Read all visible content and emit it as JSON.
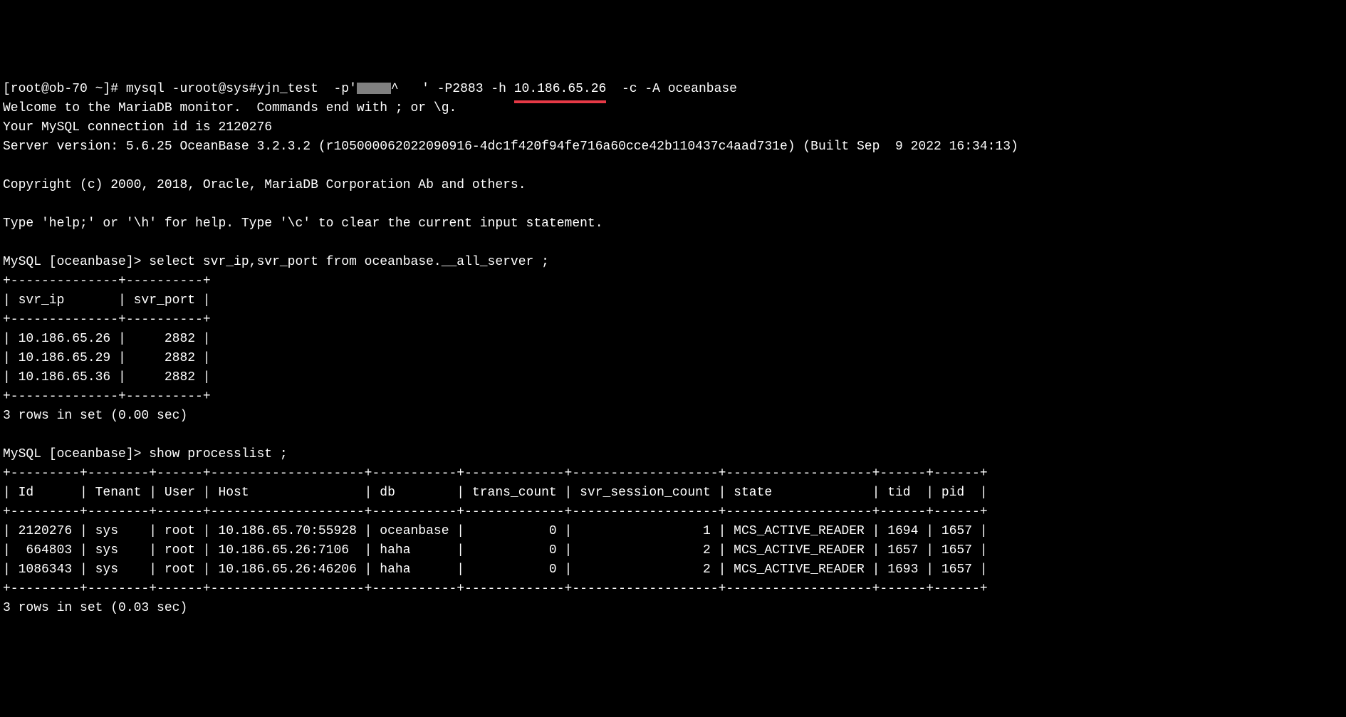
{
  "prompt_line": {
    "prompt": "[root@ob-70 ~]# ",
    "cmd_pre": "mysql -uroot@sys#yjn_test  -p'",
    "redacted": "redacted",
    "cmd_mid": "^   ' -P2883 -h ",
    "host_ip": "10.186.65.26",
    "cmd_post": "  -c -A oceanbase"
  },
  "intro": {
    "line1": "Welcome to the MariaDB monitor.  Commands end with ; or \\g.",
    "line2": "Your MySQL connection id is 2120276",
    "line3": "Server version: 5.6.25 OceanBase 3.2.3.2 (r105000062022090916-4dc1f420f94fe716a60cce42b110437c4aad731e) (Built Sep  9 2022 16:34:13)",
    "line4": "",
    "line5": "Copyright (c) 2000, 2018, Oracle, MariaDB Corporation Ab and others.",
    "line6": "",
    "line7": "Type 'help;' or '\\h' for help. Type '\\c' to clear the current input statement."
  },
  "query1": {
    "prompt": "MySQL [oceanbase]> ",
    "sql": "select svr_ip,svr_port from oceanbase.__all_server ;",
    "border_top": "+--------------+----------+",
    "header": "| svr_ip       | svr_port |",
    "border_mid": "+--------------+----------+",
    "rows": [
      "| 10.186.65.26 |     2882 |",
      "| 10.186.65.29 |     2882 |",
      "| 10.186.65.36 |     2882 |"
    ],
    "border_bot": "+--------------+----------+",
    "footer": "3 rows in set (0.00 sec)"
  },
  "query2": {
    "prompt": "MySQL [oceanbase]> ",
    "sql": "show processlist ;",
    "border_top": "+---------+--------+------+--------------------+-----------+-------------+-------------------+-------------------+------+------+",
    "header": "| Id      | Tenant | User | Host               | db        | trans_count | svr_session_count | state             | tid  | pid  |",
    "border_mid": "+---------+--------+------+--------------------+-----------+-------------+-------------------+-------------------+------+------+",
    "rows": [
      "| 2120276 | sys    | root | 10.186.65.70:55928 | oceanbase |           0 |                 1 | MCS_ACTIVE_READER | 1694 | 1657 |",
      "|  664803 | sys    | root | 10.186.65.26:7106  | haha      |           0 |                 2 | MCS_ACTIVE_READER | 1657 | 1657 |",
      "| 1086343 | sys    | root | 10.186.65.26:46206 | haha      |           0 |                 2 | MCS_ACTIVE_READER | 1693 | 1657 |"
    ],
    "border_bot": "+---------+--------+------+--------------------+-----------+-------------+-------------------+-------------------+------+------+",
    "footer": "3 rows in set (0.03 sec)"
  },
  "chart_data": {
    "type": "table",
    "tables": [
      {
        "title": "oceanbase.__all_server",
        "columns": [
          "svr_ip",
          "svr_port"
        ],
        "rows": [
          [
            "10.186.65.26",
            2882
          ],
          [
            "10.186.65.29",
            2882
          ],
          [
            "10.186.65.36",
            2882
          ]
        ]
      },
      {
        "title": "show processlist",
        "columns": [
          "Id",
          "Tenant",
          "User",
          "Host",
          "db",
          "trans_count",
          "svr_session_count",
          "state",
          "tid",
          "pid"
        ],
        "rows": [
          [
            2120276,
            "sys",
            "root",
            "10.186.65.70:55928",
            "oceanbase",
            0,
            1,
            "MCS_ACTIVE_READER",
            1694,
            1657
          ],
          [
            664803,
            "sys",
            "root",
            "10.186.65.26:7106",
            "haha",
            0,
            2,
            "MCS_ACTIVE_READER",
            1657,
            1657
          ],
          [
            1086343,
            "sys",
            "root",
            "10.186.65.26:46206",
            "haha",
            0,
            2,
            "MCS_ACTIVE_READER",
            1693,
            1657
          ]
        ]
      }
    ]
  }
}
